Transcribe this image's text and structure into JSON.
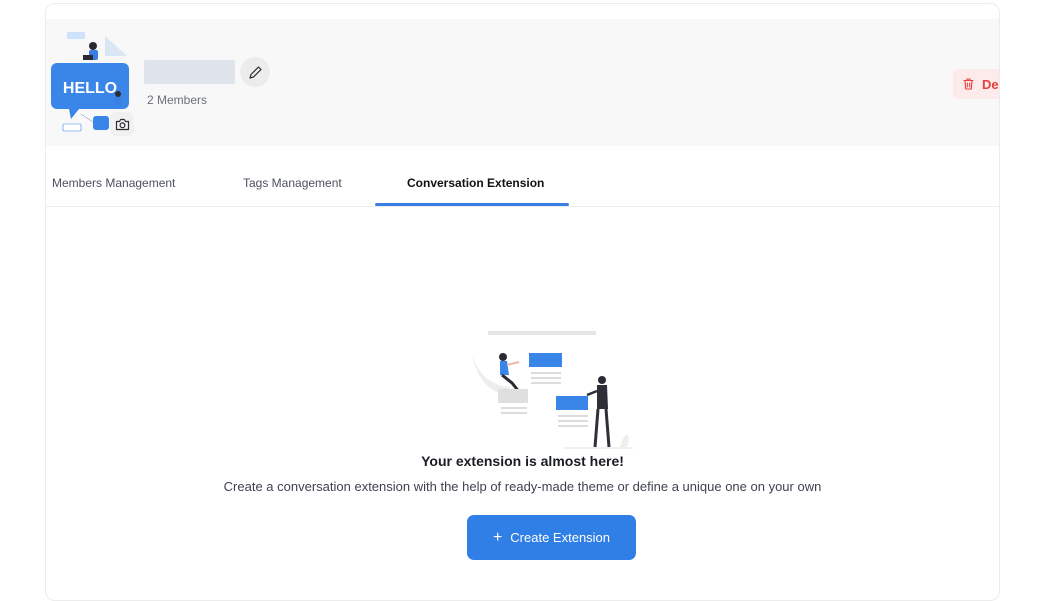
{
  "group": {
    "avatar_text": "HELLO",
    "members_count": "2 Members",
    "delete_label": "De"
  },
  "tabs": [
    {
      "label": "Members Management",
      "active": false
    },
    {
      "label": "Tags Management",
      "active": false
    },
    {
      "label": "Conversation Extension",
      "active": true
    }
  ],
  "empty_state": {
    "title": "Your extension is almost here!",
    "description": "Create a conversation extension with the help of ready-made theme or define a unique one on your own",
    "button_label": "Create Extension",
    "button_icon": "plus-icon"
  },
  "colors": {
    "accent": "#2f7fe6",
    "danger": "#e5403f",
    "danger_bg": "#fdeaea"
  }
}
